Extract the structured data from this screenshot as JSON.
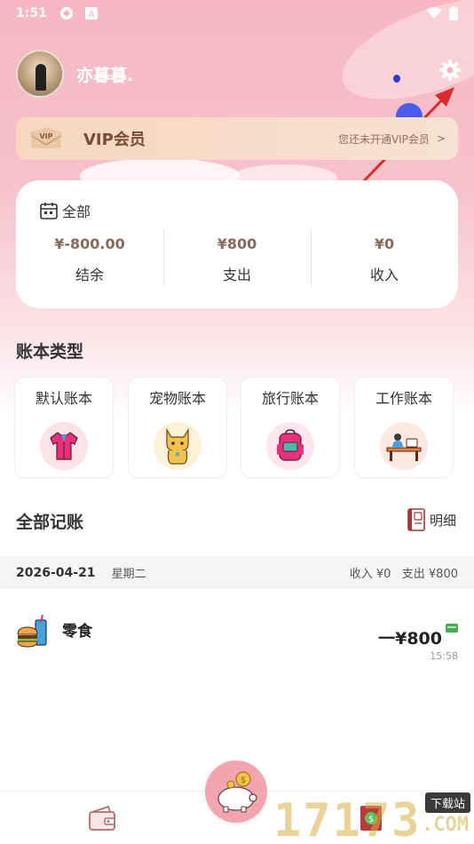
{
  "status_bar": {
    "time": "1:51"
  },
  "profile": {
    "username": "亦暮暮."
  },
  "vip": {
    "title": "VIP会员",
    "note": "您还未开通VIP会员",
    "badge": "VIP"
  },
  "summary": {
    "filter_label": "全部",
    "stats": [
      {
        "value": "¥-800.00",
        "label": "结余"
      },
      {
        "value": "¥800",
        "label": "支出"
      },
      {
        "value": "¥0",
        "label": "收入"
      }
    ]
  },
  "books": {
    "title": "账本类型",
    "items": [
      {
        "name": "默认账本",
        "icon": "shirt-icon"
      },
      {
        "name": "宠物账本",
        "icon": "cat-icon"
      },
      {
        "name": "旅行账本",
        "icon": "backpack-icon"
      },
      {
        "name": "工作账本",
        "icon": "desk-icon"
      }
    ]
  },
  "records": {
    "title": "全部记账",
    "detail_label": "明细",
    "groups": [
      {
        "date": "2026-04-21",
        "weekday": "星期二",
        "totals": "收入 ¥0   支出 ¥800",
        "items": [
          {
            "category": "零食",
            "amount": "一¥800",
            "time": "15:58",
            "icon": "snack-icon"
          }
        ]
      }
    ]
  },
  "watermark": {
    "digits": "17173",
    "tag": "下载站",
    "suffix": ".COM"
  },
  "colors": {
    "accent_pink": "#f2a5ae",
    "vip_text": "#7a4a32",
    "stat_value": "#8a6a5c"
  }
}
